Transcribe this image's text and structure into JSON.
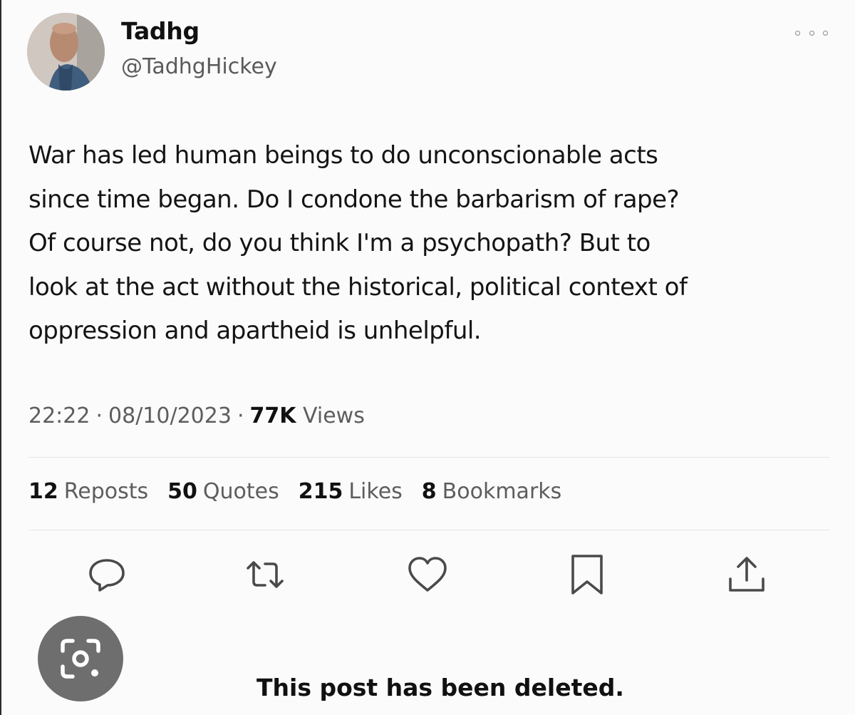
{
  "author": {
    "name": "Tadhg",
    "handle": "@TadhgHickey"
  },
  "tweet": {
    "text": "War has led human beings to do unconscionable acts\nsince time began. Do I condone the barbarism of rape?\nOf course not, do you think I'm a psychopath? But to\nlook at the act without the historical, political context of\noppression and apartheid is unhelpful.",
    "time": "22:22",
    "date": "08/10/2023",
    "views_count": "77K",
    "views_label": "Views",
    "separator": "·"
  },
  "stats": [
    {
      "count": "12",
      "label": "Reposts"
    },
    {
      "count": "50",
      "label": "Quotes"
    },
    {
      "count": "215",
      "label": "Likes"
    },
    {
      "count": "8",
      "label": "Bookmarks"
    }
  ],
  "actions": [
    "reply-icon",
    "repost-icon",
    "like-icon",
    "bookmark-icon",
    "share-icon"
  ],
  "overlay": {
    "lens_icon": "lens-camera-icon",
    "caption": "This post has been deleted."
  },
  "colors": {
    "background": "#fcfbfb",
    "text_primary": "#141414",
    "text_secondary": "#5d5d5d",
    "icon": "#4a4a4a",
    "lens_button": "#6e6e6e"
  }
}
